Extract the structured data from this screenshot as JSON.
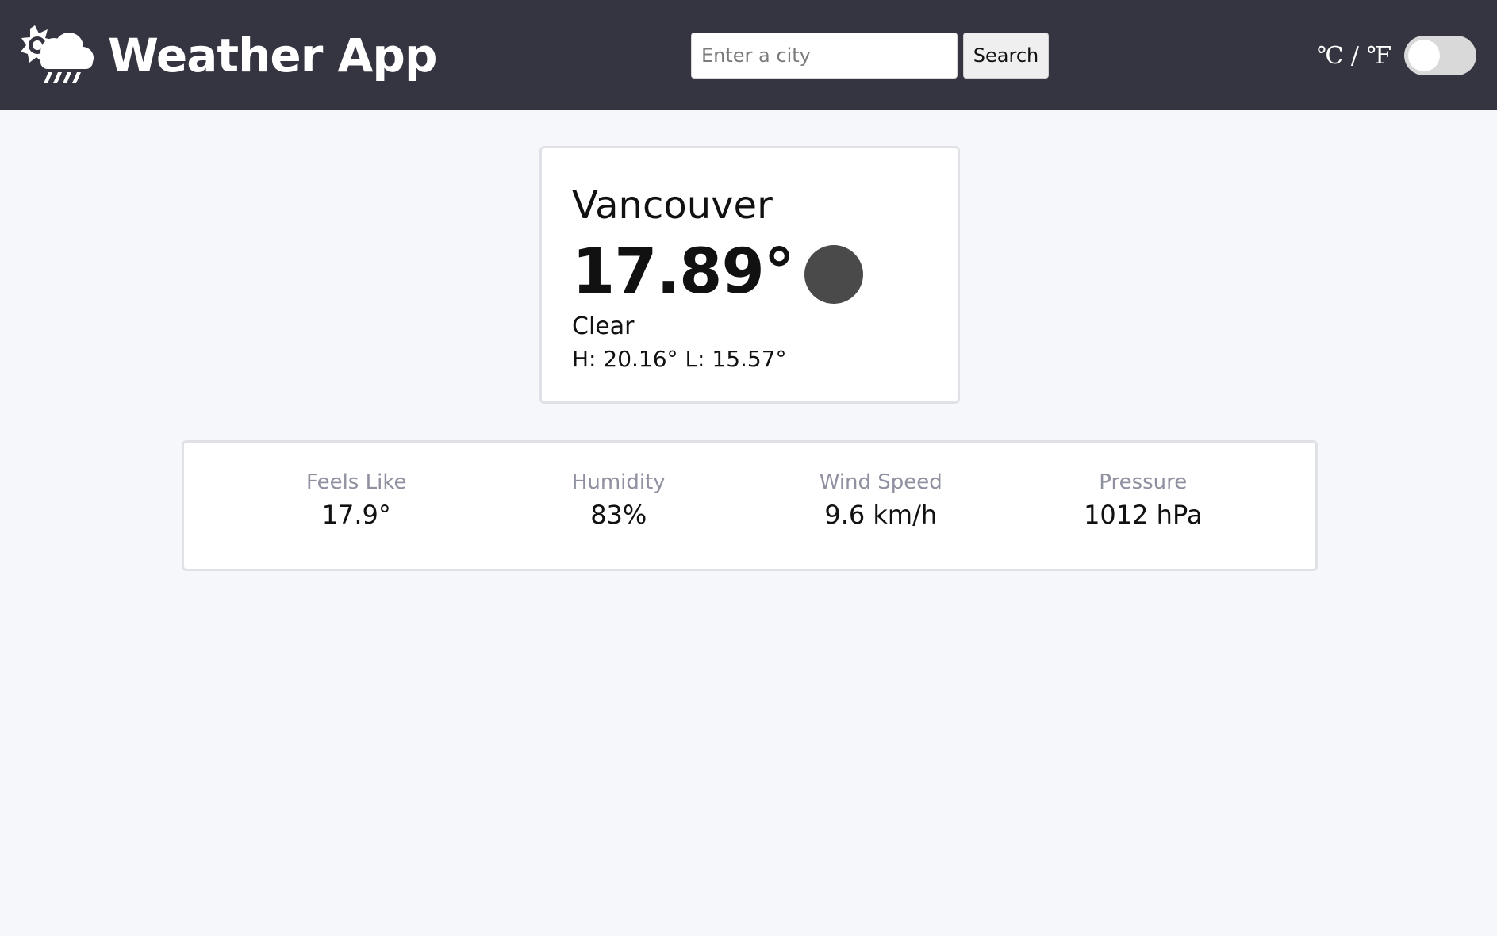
{
  "header": {
    "app_icon": "cloud-sun-rain-icon",
    "title": "Weather App",
    "search": {
      "placeholder": "Enter a city",
      "value": "",
      "button_label": "Search"
    },
    "unit_toggle": {
      "label": "℃ / ℉",
      "checked": false
    }
  },
  "weather_card": {
    "city": "Vancouver",
    "temperature": "17.89°",
    "condition": "Clear",
    "high_low": "H: 20.16° L: 15.57°",
    "icon": "weather-icon-placeholder"
  },
  "details": [
    {
      "label": "Feels Like",
      "value": "17.9°"
    },
    {
      "label": "Humidity",
      "value": "83%"
    },
    {
      "label": "Wind Speed",
      "value": "9.6 km/h"
    },
    {
      "label": "Pressure",
      "value": "1012 hPa"
    }
  ],
  "colors": {
    "header": "#353541",
    "page_background": "#f6f7fa",
    "card_border": "#dfe1e7",
    "label_text": "#8f90a0",
    "toggle_track": "#d9d9d9",
    "weather_icon": "#4a4a4a"
  }
}
